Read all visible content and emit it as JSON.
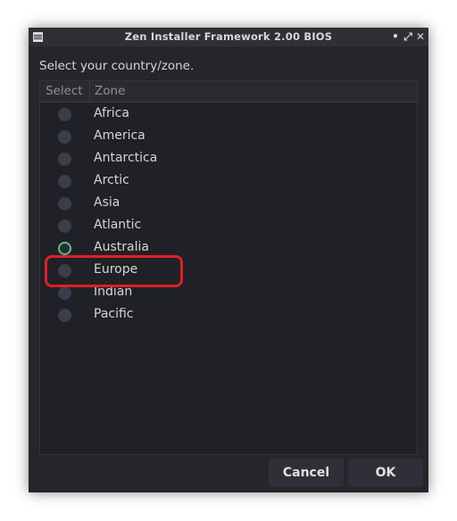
{
  "window": {
    "title": "Zen Installer Framework 2.00 BIOS",
    "controls": {
      "minimize": "•",
      "maximize": "⤢",
      "close": "✕"
    }
  },
  "prompt": "Select your country/zone.",
  "list": {
    "columns": {
      "select": "Select",
      "zone": "Zone"
    },
    "rows": [
      {
        "label": "Africa",
        "checked": false
      },
      {
        "label": "America",
        "checked": false
      },
      {
        "label": "Antarctica",
        "checked": false
      },
      {
        "label": "Arctic",
        "checked": false
      },
      {
        "label": "Asia",
        "checked": false
      },
      {
        "label": "Atlantic",
        "checked": false
      },
      {
        "label": "Australia",
        "checked": true
      },
      {
        "label": "Europe",
        "checked": false
      },
      {
        "label": "Indian",
        "checked": false
      },
      {
        "label": "Pacific",
        "checked": false
      }
    ]
  },
  "buttons": {
    "cancel": "Cancel",
    "ok": "OK"
  },
  "colors": {
    "window_bg": "#25262b",
    "list_bg": "#202126",
    "radio_checked": "#55c08a",
    "highlight": "#e01f26"
  },
  "icons": {
    "window_menu": "window-menu-icon"
  }
}
